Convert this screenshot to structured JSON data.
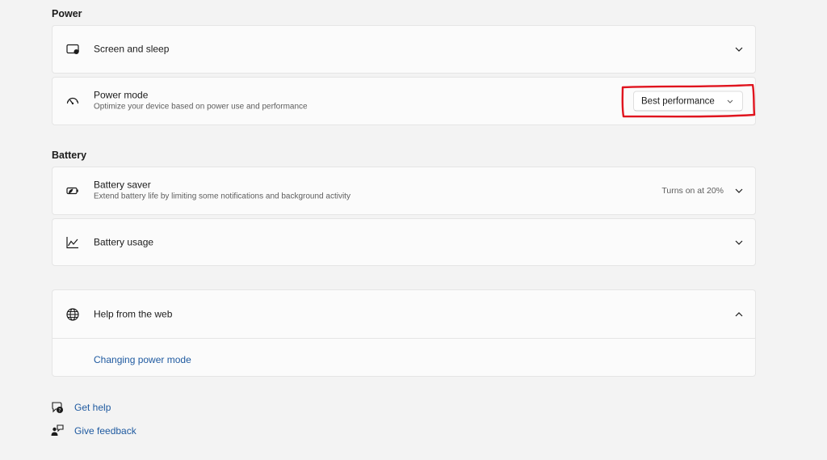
{
  "sections": {
    "power_title": "Power",
    "battery_title": "Battery"
  },
  "power": {
    "screen_sleep": {
      "title": "Screen and sleep",
      "icon": "screen-sleep-icon"
    },
    "power_mode": {
      "title": "Power mode",
      "subtitle": "Optimize your device based on power use and performance",
      "icon": "gauge-icon",
      "selected": "Best performance"
    }
  },
  "battery": {
    "saver": {
      "title": "Battery saver",
      "subtitle": "Extend battery life by limiting some notifications and background activity",
      "status": "Turns on at 20%",
      "icon": "battery-saver-icon"
    },
    "usage": {
      "title": "Battery usage",
      "icon": "chart-line-icon"
    }
  },
  "help": {
    "title": "Help from the web",
    "icon": "globe-icon",
    "link": "Changing power mode"
  },
  "footer": {
    "get_help": "Get help",
    "give_feedback": "Give feedback"
  },
  "colors": {
    "accent_link": "#1f5aa0",
    "highlight": "#e0141e",
    "card_bg": "#fbfbfb",
    "page_bg": "#f3f3f3"
  }
}
